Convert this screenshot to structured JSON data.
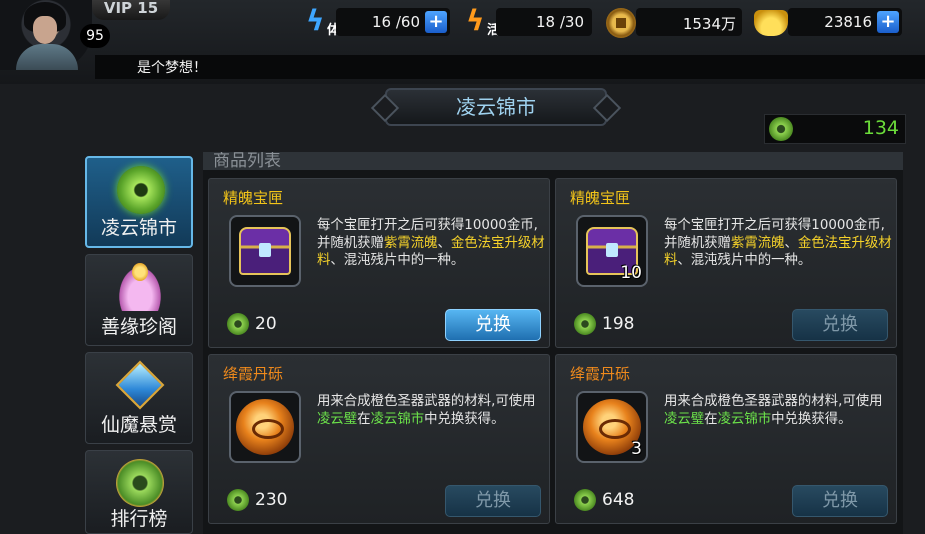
{
  "player": {
    "vip_label": "VIP 15",
    "level": "95",
    "ticker_text": "是个梦想！"
  },
  "resources": {
    "stamina_tag": "体",
    "stamina": "16 /60",
    "vigor_tag": "活",
    "vigor": "18 /30",
    "coins": "1534万",
    "gold": "23816",
    "add_symbol": "+"
  },
  "shop": {
    "title": "凌云锦市",
    "jade_balance": "134",
    "list_header": "商品列表"
  },
  "sidebar": {
    "items": [
      {
        "label": "凌云锦市",
        "icon": "jade-coin-icon"
      },
      {
        "label": "善缘珍阁",
        "icon": "lotus-icon"
      },
      {
        "label": "仙魔悬赏",
        "icon": "gem-icon"
      },
      {
        "label": "排行榜",
        "icon": "jade-medal-icon"
      }
    ]
  },
  "items": [
    {
      "name": "精魄宝匣",
      "name_color": "#f2c419",
      "icon": "treasure-chest-icon",
      "quantity": "",
      "desc_parts": [
        "每个宝匣打开之后可获得10000金币,并随机获赠",
        "紫霄流魄",
        "、",
        "金色法宝升级材料",
        "、混沌残片中的一种。"
      ],
      "price": "20",
      "button": "兑换",
      "enabled": true
    },
    {
      "name": "精魄宝匣",
      "name_color": "#f2c419",
      "icon": "treasure-chest-icon",
      "quantity": "10",
      "desc_parts": [
        "每个宝匣打开之后可获得10000金币,并随机获赠",
        "紫霄流魄",
        "、",
        "金色法宝升级材料",
        "、混沌残片中的一种。"
      ],
      "price": "198",
      "button": "兑换",
      "enabled": false
    },
    {
      "name": "绛霞丹砾",
      "name_color": "#f08a1c",
      "icon": "orange-ore-icon",
      "quantity": "",
      "desc_parts": [
        "用来合成橙色圣器武器的材料,可使用",
        "凌云璧",
        "在",
        "凌云锦市",
        "中兑换获得。"
      ],
      "price": "230",
      "button": "兑换",
      "enabled": false
    },
    {
      "name": "绛霞丹砾",
      "name_color": "#f08a1c",
      "icon": "orange-ore-icon",
      "quantity": "3",
      "desc_parts": [
        "用来合成橙色圣器武器的材料,可使用",
        "凌云璧",
        "在",
        "凌云锦市",
        "中兑换获得。"
      ],
      "price": "648",
      "button": "兑换",
      "enabled": false
    }
  ]
}
